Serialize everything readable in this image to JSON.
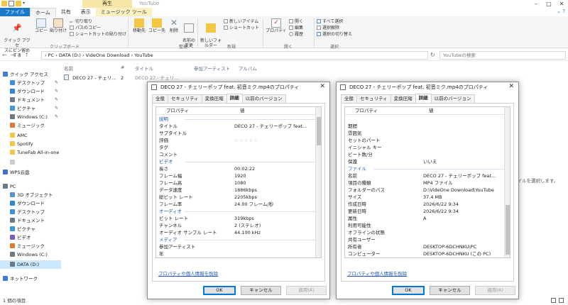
{
  "explorer": {
    "context_tab": "再生",
    "window_title": "YouTube",
    "tabs": [
      "ファイル",
      "ホーム",
      "共有",
      "表示",
      "ミュージック ツール"
    ],
    "ribbon": {
      "clipboard": {
        "pin": "クイック アクセ\nスにピン留めする",
        "copy": "コピー",
        "paste": "貼り付け",
        "cut": "切り取り",
        "copy_path": "パスのコピー",
        "paste_shortcut": "ショートカットの貼り付け",
        "label": "クリップボード"
      },
      "organize": {
        "move_to": "移動先",
        "copy_to": "コピー先",
        "delete": "削除",
        "rename": "名前の\n変更",
        "label": "整理"
      },
      "new": {
        "new_folder": "新しいフォ\nルダー",
        "new_item": "新しいアイテム",
        "easy_access": "ショートカット",
        "label": "新規"
      },
      "open": {
        "properties": "プロパティ",
        "open": "開く",
        "edit": "編集",
        "history": "履歴",
        "label": "開く"
      },
      "select": {
        "select_all": "すべて選択",
        "select_none": "選択解除",
        "invert": "選択の切り替え",
        "label": "選択"
      }
    },
    "address": "› PC › DATA (D:) › VideOne Download › YouTube",
    "search_placeholder": "YouTubeの検索",
    "nav_pane": [
      {
        "label": "クイック アクセス",
        "pin": false
      },
      {
        "label": "デスクトップ",
        "pin": true
      },
      {
        "label": "ダウンロード",
        "pin": true
      },
      {
        "label": "ドキュメント",
        "pin": true
      },
      {
        "label": "ピクチャ",
        "pin": true
      },
      {
        "label": "Windows (C:)",
        "pin": true
      },
      {
        "label": "ミュージック",
        "pin": false
      },
      {
        "label": "AMC",
        "pin": false
      },
      {
        "label": "Spotify",
        "pin": false
      },
      {
        "label": "TuneFab All-in-one M",
        "pin": false
      },
      {
        "label": "",
        "pin": false
      },
      {
        "label": "WPS云盘",
        "pin": false
      },
      {
        "label": "PC",
        "pin": false
      },
      {
        "label": "3D オブジェクト",
        "pin": false
      },
      {
        "label": "ダウンロード",
        "pin": false
      },
      {
        "label": "デスクトップ",
        "pin": false
      },
      {
        "label": "ドキュメント",
        "pin": false
      },
      {
        "label": "ピクチャ",
        "pin": false
      },
      {
        "label": "ビデオ",
        "pin": false
      },
      {
        "label": "ミュージック",
        "pin": false
      },
      {
        "label": "Windows (C:)",
        "pin": false
      },
      {
        "label": "DATA (D:)",
        "pin": false
      },
      {
        "label": "ネットワーク",
        "pin": false
      }
    ],
    "columns": [
      "名前",
      "#",
      "タイトル",
      "参加アーティスト",
      "アルバム"
    ],
    "file": {
      "name": "DECO 27 - チェリ...",
      "num": "2",
      "title": "DECO 27 - チェリ..."
    },
    "right_message": "ァイルを選択します。",
    "status": "1 個の項目"
  },
  "dialog1": {
    "title": "DECO 27 - チェリーポップ feat. 初音ミク.mp4のプロパティ",
    "tabs": [
      "全般",
      "セキュリティ",
      "詳細",
      "変換圧縮",
      "以前のバージョン"
    ],
    "selected_tab": "詳細",
    "col_property": "プロパティ",
    "col_value": "値",
    "rows": [
      {
        "k": "説明",
        "v": "",
        "sec": true
      },
      {
        "k": "タイトル",
        "v": "DECO 27 - チェリーポップ feat...",
        "sec": false
      },
      {
        "k": "サブタイトル",
        "v": "",
        "sec": false
      },
      {
        "k": "評価",
        "v": "☆☆☆☆☆",
        "sec": false
      },
      {
        "k": "タグ",
        "v": "",
        "sec": false
      },
      {
        "k": "コメント",
        "v": "",
        "sec": false
      },
      {
        "k": "ビデオ",
        "v": "",
        "sec": true
      },
      {
        "k": "長さ",
        "v": "00:02:22",
        "sec": false
      },
      {
        "k": "フレーム幅",
        "v": "1920",
        "sec": false
      },
      {
        "k": "フレーム高",
        "v": "1080",
        "sec": false
      },
      {
        "k": "データ速度",
        "v": "1886kbps",
        "sec": false
      },
      {
        "k": "総ビット レート",
        "v": "2205kbps",
        "sec": false
      },
      {
        "k": "フレーム率",
        "v": "24.00 フレーム/秒",
        "sec": false
      },
      {
        "k": "オーディオ",
        "v": "",
        "sec": true
      },
      {
        "k": "ビット レート",
        "v": "319kbps",
        "sec": false
      },
      {
        "k": "チャンネル",
        "v": "2 (ステレオ)",
        "sec": false
      },
      {
        "k": "オーディオ サンプル レート",
        "v": "44.100 kHz",
        "sec": false
      },
      {
        "k": "メディア",
        "v": "",
        "sec": true
      },
      {
        "k": "参加アーティスト",
        "v": "",
        "sec": false
      },
      {
        "k": "年",
        "v": "",
        "sec": false
      }
    ],
    "link": "プロパティや個人情報を削除",
    "ok": "OK",
    "cancel": "キャンセル",
    "apply": "適用(A)"
  },
  "dialog2": {
    "title": "DECO 27 - チェリーポップ feat. 初音ミク.mp4のプロパティ",
    "tabs": [
      "全般",
      "セキュリティ",
      "変換圧縮",
      "詳細",
      "以前のバージョン"
    ],
    "selected_tab": "詳細",
    "col_property": "プロパティ",
    "col_value": "値",
    "rows": [
      {
        "k": "期間",
        "v": "",
        "sec": false
      },
      {
        "k": "雰囲気",
        "v": "",
        "sec": false
      },
      {
        "k": "セットのパート",
        "v": "",
        "sec": false
      },
      {
        "k": "イニシャル キー",
        "v": "",
        "sec": false
      },
      {
        "k": "ビート数/分",
        "v": "",
        "sec": false
      },
      {
        "k": "保護",
        "v": "いいえ",
        "sec": false
      },
      {
        "k": "ファイル",
        "v": "",
        "sec": true
      },
      {
        "k": "名前",
        "v": "DECO 27 - チェリーポップ feat...",
        "sec": false
      },
      {
        "k": "項目の種類",
        "v": "MP4 ファイル",
        "sec": false
      },
      {
        "k": "フォルダーのパス",
        "v": "D:\\VideOne Download\\YouTube",
        "sec": false
      },
      {
        "k": "サイズ",
        "v": "37.4 MB",
        "sec": false
      },
      {
        "k": "作成日時",
        "v": "2026/6/22 9:34",
        "sec": false
      },
      {
        "k": "更新日時",
        "v": "2026/6/22 9:34",
        "sec": false
      },
      {
        "k": "属性",
        "v": "A",
        "sec": false
      },
      {
        "k": "利用可能性",
        "v": "",
        "sec": false
      },
      {
        "k": "オフラインの状態",
        "v": "",
        "sec": false
      },
      {
        "k": "共有ユーザー",
        "v": "",
        "sec": false
      },
      {
        "k": "所有者",
        "v": "DESKTOP-6DCHNKU\\PC",
        "sec": false
      },
      {
        "k": "コンピューター",
        "v": "DESKTOP-6DCHNKU (この PC)",
        "sec": false
      }
    ],
    "link": "プロパティや個人情報を削除",
    "ok": "OK",
    "cancel": "キャンセル",
    "apply": "適用(A)"
  },
  "colors": {
    "file_tab": "#1979ca",
    "context_tab": "#f7e7a7",
    "selection": "#cce8ff",
    "section": "#1a57b0",
    "default_button": "#0078d7"
  }
}
